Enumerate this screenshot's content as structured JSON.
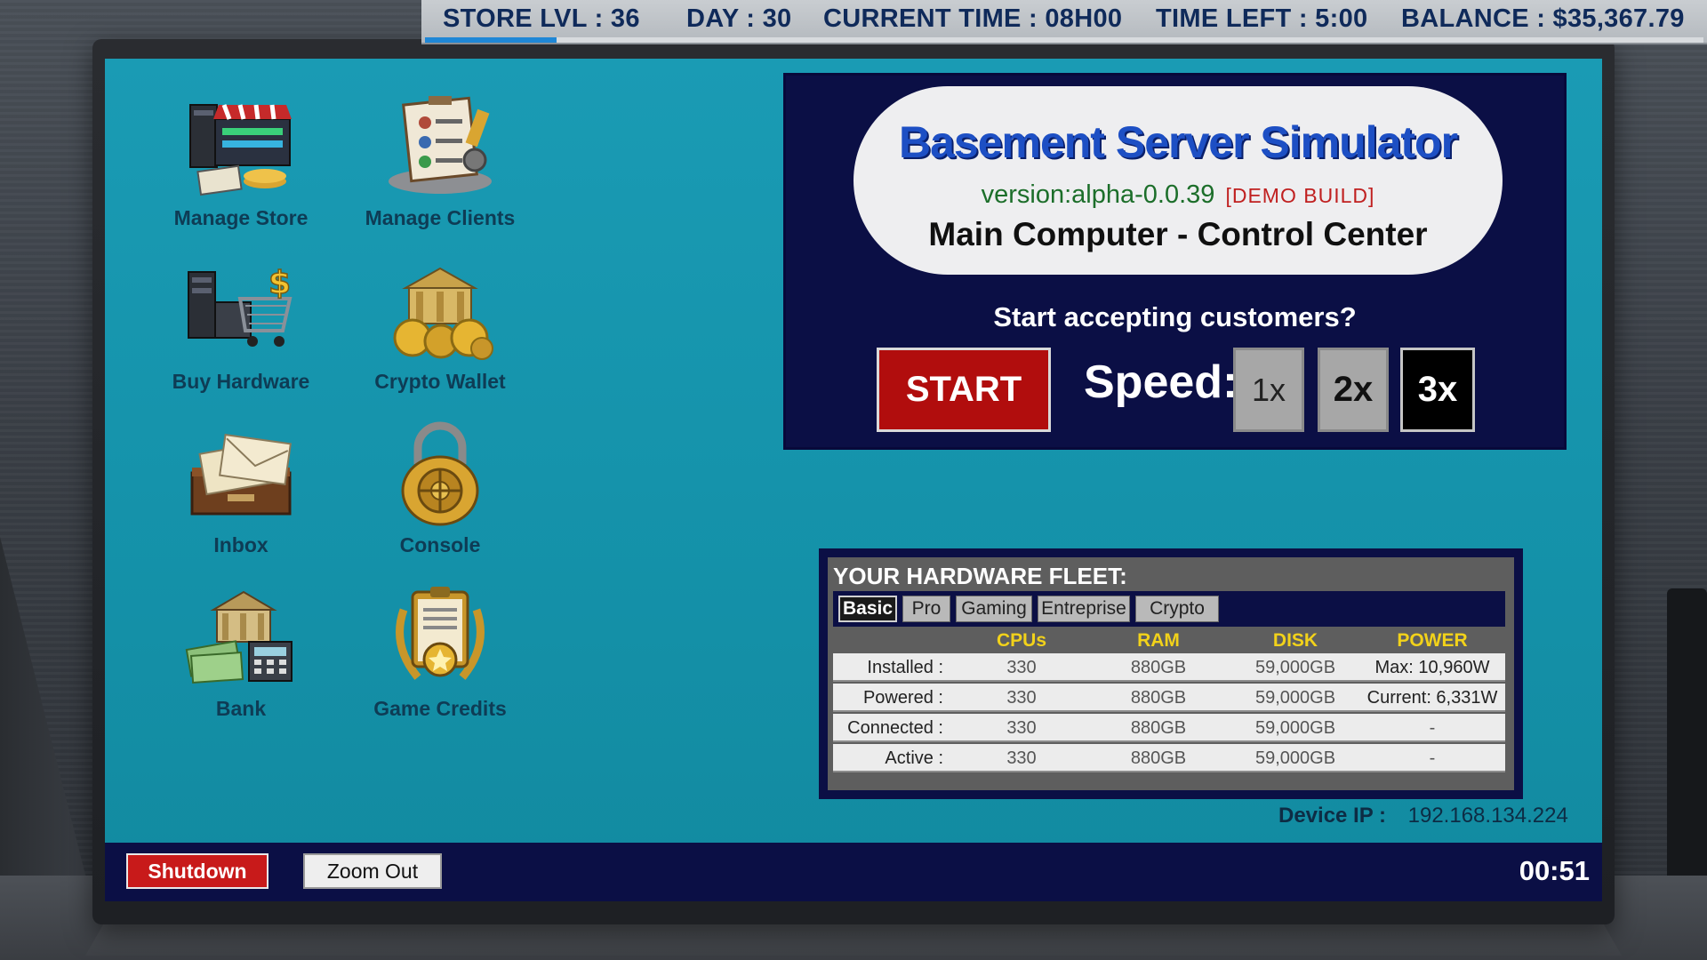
{
  "hud": {
    "store_level": "STORE LVL : 36",
    "day": "DAY : 30",
    "current_time": "CURRENT TIME : 08H00",
    "time_left": "TIME LEFT : 5:00",
    "balance": "BALANCE : $35,367.79",
    "progress_fraction": 0.103
  },
  "desktop_icons": [
    {
      "label": "Manage Store",
      "icon": "store-icon"
    },
    {
      "label": "Manage Clients",
      "icon": "clients-icon"
    },
    {
      "label": "Buy Hardware",
      "icon": "shopping-cart-icon"
    },
    {
      "label": "Crypto Wallet",
      "icon": "crypto-bank-icon"
    },
    {
      "label": "Inbox",
      "icon": "mail-icon"
    },
    {
      "label": "Console",
      "icon": "lock-icon"
    },
    {
      "label": "Bank",
      "icon": "bank-icon"
    },
    {
      "label": "Game Credits",
      "icon": "credits-icon"
    }
  ],
  "control_panel": {
    "title": "Basement Server Simulator",
    "version": "version:alpha-0.0.39",
    "demo_tag": "[DEMO BUILD]",
    "subtitle": "Main Computer - Control Center",
    "question": "Start accepting customers?",
    "start_label": "START",
    "speed_label": "Speed:",
    "speed_options": [
      "1x",
      "2x",
      "3x"
    ],
    "selected_speed": "3x"
  },
  "fleet": {
    "title": "YOUR HARDWARE FLEET:",
    "tabs": [
      "Basic",
      "Pro",
      "Gaming",
      "Entreprise",
      "Crypto"
    ],
    "active_tab": "Basic",
    "columns": [
      "CPUs",
      "RAM",
      "DISK",
      "POWER"
    ],
    "rows": [
      {
        "label": "Installed :",
        "cpus": "330",
        "ram": "880GB",
        "disk": "59,000GB",
        "power": "Max: 10,960W"
      },
      {
        "label": "Powered :",
        "cpus": "330",
        "ram": "880GB",
        "disk": "59,000GB",
        "power": "Current: 6,331W"
      },
      {
        "label": "Connected :",
        "cpus": "330",
        "ram": "880GB",
        "disk": "59,000GB",
        "power": "-"
      },
      {
        "label": "Active :",
        "cpus": "330",
        "ram": "880GB",
        "disk": "59,000GB",
        "power": "-"
      }
    ]
  },
  "device_ip": {
    "label": "Device IP :",
    "value": "192.168.134.224"
  },
  "taskbar": {
    "shutdown_label": "Shutdown",
    "zoom_label": "Zoom Out",
    "clock": "00:51"
  },
  "colors": {
    "screen_bg": "#1593ab",
    "panel_bg": "#0b0f45",
    "start_red": "#b10d0d",
    "title_blue": "#1d4fc4",
    "version_green": "#1c6e2a",
    "fleet_header_yellow": "#f2d21a"
  }
}
